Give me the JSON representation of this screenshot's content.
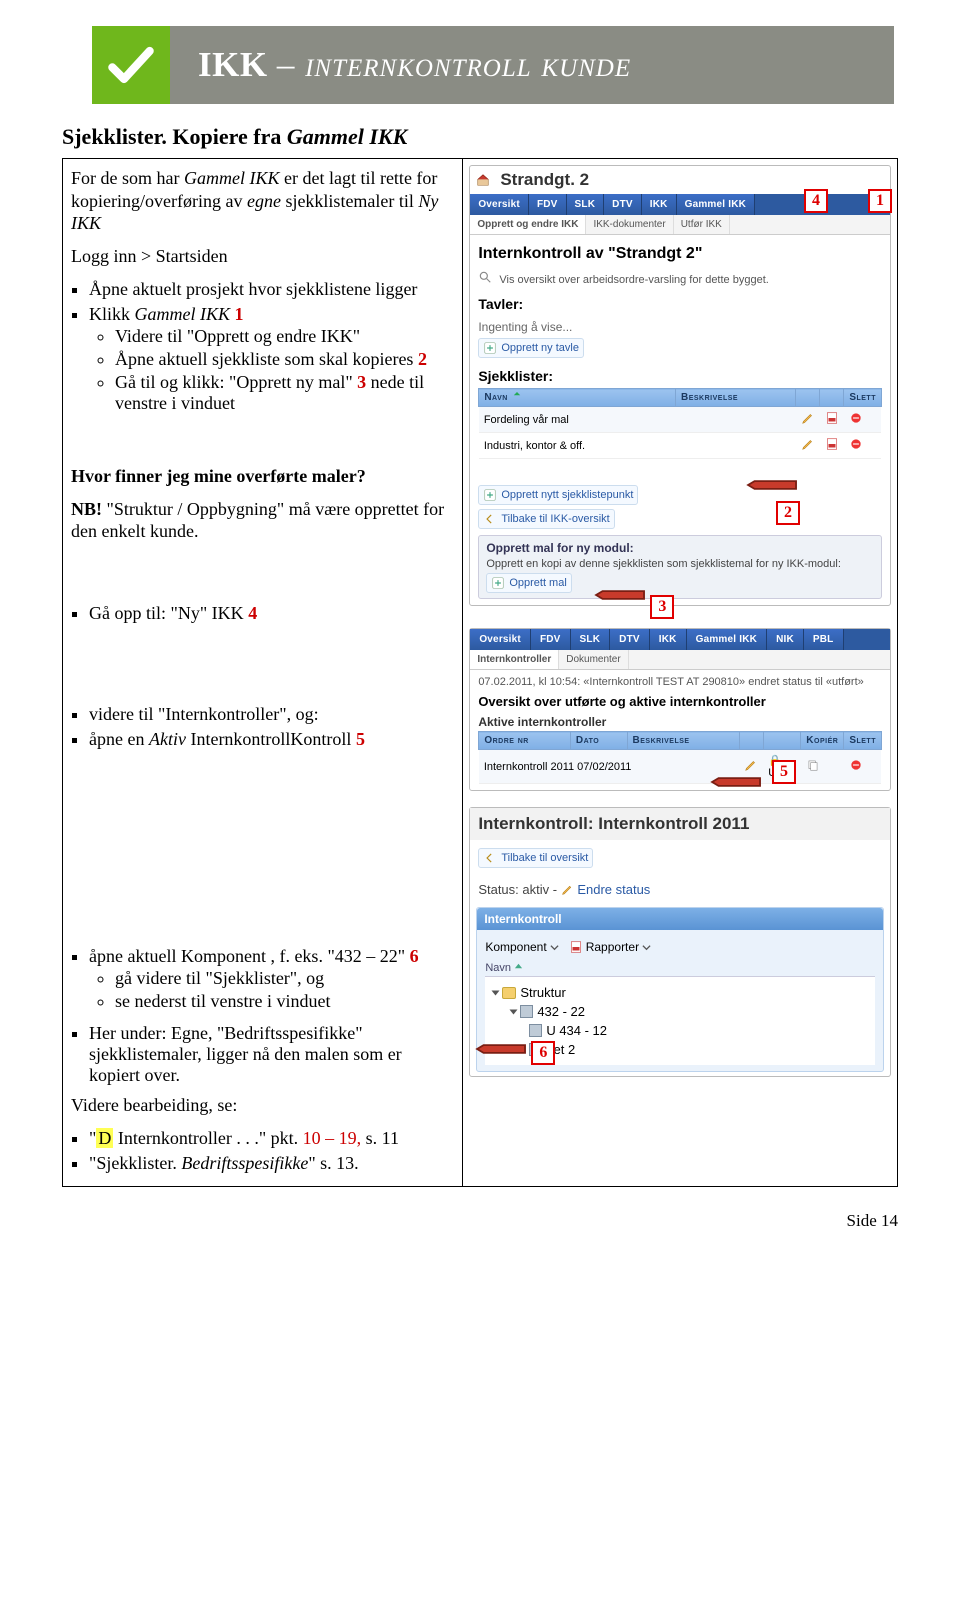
{
  "banner": {
    "title_main": "IKK",
    "title_sub": "– internkontroll kunde"
  },
  "title": {
    "pre": "Sjekklister. Kopiere fra",
    "em": "Gammel IKK"
  },
  "intro": {
    "a": "For de som har",
    "a_em": "Gammel IKK",
    "a2": "er det lagt til rette for kopiering/overføring av",
    "a_em2": "egne",
    "a3": "sjekklistemaler til",
    "a_em3": "Ny IKK"
  },
  "left": {
    "b1": "Logg inn > Startsiden",
    "b2": "Åpne aktuelt prosjekt hvor sjekklistene ligger",
    "b3_pre": "Klikk",
    "b3_em": "Gammel IKK",
    "s31": "Videre til \"Opprett og endre IKK\"",
    "s32_a": "Åpne aktuell sjekkliste som skal kopieres",
    "s33_a": "Gå til og klikk: \"Opprett ny mal\"",
    "s33_b": "nede til venstre i vinduet",
    "q1": "Hvor finner jeg mine overførte maler?",
    "q2_nb": "NB!",
    "q2": "\"Struktur / Oppbygning\" må være opprettet for den enkelt kunde.",
    "b4_a": "Gå opp til: \"Ny\" IKK",
    "b5a": "videre til \"Internkontroller\", og:",
    "b5b_pre": "åpne en",
    "b5b_em": "Aktiv",
    "b5b_post": "InternkontrollKontroll",
    "b6_a": "åpne aktuell Komponent , f. eks. \"432 – 22\"",
    "s61": "gå videre til \"Sjekklister\", og",
    "s62": "se nederst til venstre i vinduet",
    "b7": "Her under: Egne, \"Bedriftsspesifikke\" sjekklistemaler, ligger nå den malen som er kopiert over.",
    "vb": "Videre bearbeiding, se:",
    "v1_pre": "\"",
    "v1_hl": "D",
    "v1_post": " Internkontroller . . .\" pkt.",
    "v1_red": "10 – 19,",
    "v1_tail": "s. 11",
    "v2": "\"Sjekklister.",
    "v2_em": "Bedriftsspesifikke",
    "v2_tail": "\" s. 13."
  },
  "scr1": {
    "addr": "Strandgt. 2",
    "navs": [
      "Oversikt",
      "FDV",
      "SLK",
      "DTV",
      "IKK",
      "Gammel IKK"
    ],
    "subtabs": [
      "Opprett og endre IKK",
      "IKK-dokumenter",
      "Utfør IKK"
    ],
    "head": "Internkontroll av \"Strandgt 2\"",
    "note_pre": "Vis oversikt over arbeidsordre-varsling for dette bygget.",
    "sec_tavler": "Tavler:",
    "tavler_empty": "Ingenting å vise...",
    "tavler_btn": "Opprett ny tavle",
    "sec_sjekk": "Sjekklister:",
    "th_navn": "Navn",
    "th_besk": "Beskrivelse",
    "th_slett": "Slett",
    "row1": "Fordeling vår mal",
    "row2": "Industri, kontor & off.",
    "btn_nytt": "Opprett nytt sjekklistepunkt",
    "btn_tilbake": "Tilbake til IKK-oversikt",
    "mal_head": "Opprett mal for ny modul:",
    "mal_txt": "Opprett en kopi av denne sjekklisten som sjekklistemal for ny IKK-modul:",
    "mal_btn": "Opprett mal"
  },
  "scr2": {
    "navs": [
      "Oversikt",
      "FDV",
      "SLK",
      "DTV",
      "IKK",
      "Gammel IKK",
      "NIK",
      "PBL"
    ],
    "subtabs": [
      "Internkontroller",
      "Dokumenter"
    ],
    "status_line": "07.02.2011, kl 10:54: «Internkontroll TEST AT 290810» endret status til «utført»",
    "h1": "Oversikt over utførte og aktive internkontroller",
    "h2": "Aktive internkontroller",
    "th_ordre": "Ordre nr",
    "th_dato": "Dato",
    "th_besk": "Beskrivelse",
    "th_kop": "Kopiér",
    "th_slett": "Slett",
    "row_name": "Internkontroll 2011 07/02/2011",
    "row_stat": "Utført"
  },
  "scr3": {
    "title": "Internkontroll: Internkontroll 2011",
    "btn_back": "Tilbake til oversikt",
    "status_lbl": "Status: aktiv -",
    "status_link": "Endre status",
    "side_head": "Internkontroll",
    "tb_komp": "Komponent",
    "tb_rapp": "Rapporter",
    "col_navn": "Navn",
    "tree_root": "Struktur",
    "tree_1": "432 - 22",
    "tree_2": "U 434 - 12",
    "tree_3": "net 2"
  },
  "callouts": {
    "c1": "1",
    "c2": "2",
    "c3": "3",
    "c4": "4",
    "c5": "5",
    "c6": "6"
  },
  "pagenum": "Side 14"
}
